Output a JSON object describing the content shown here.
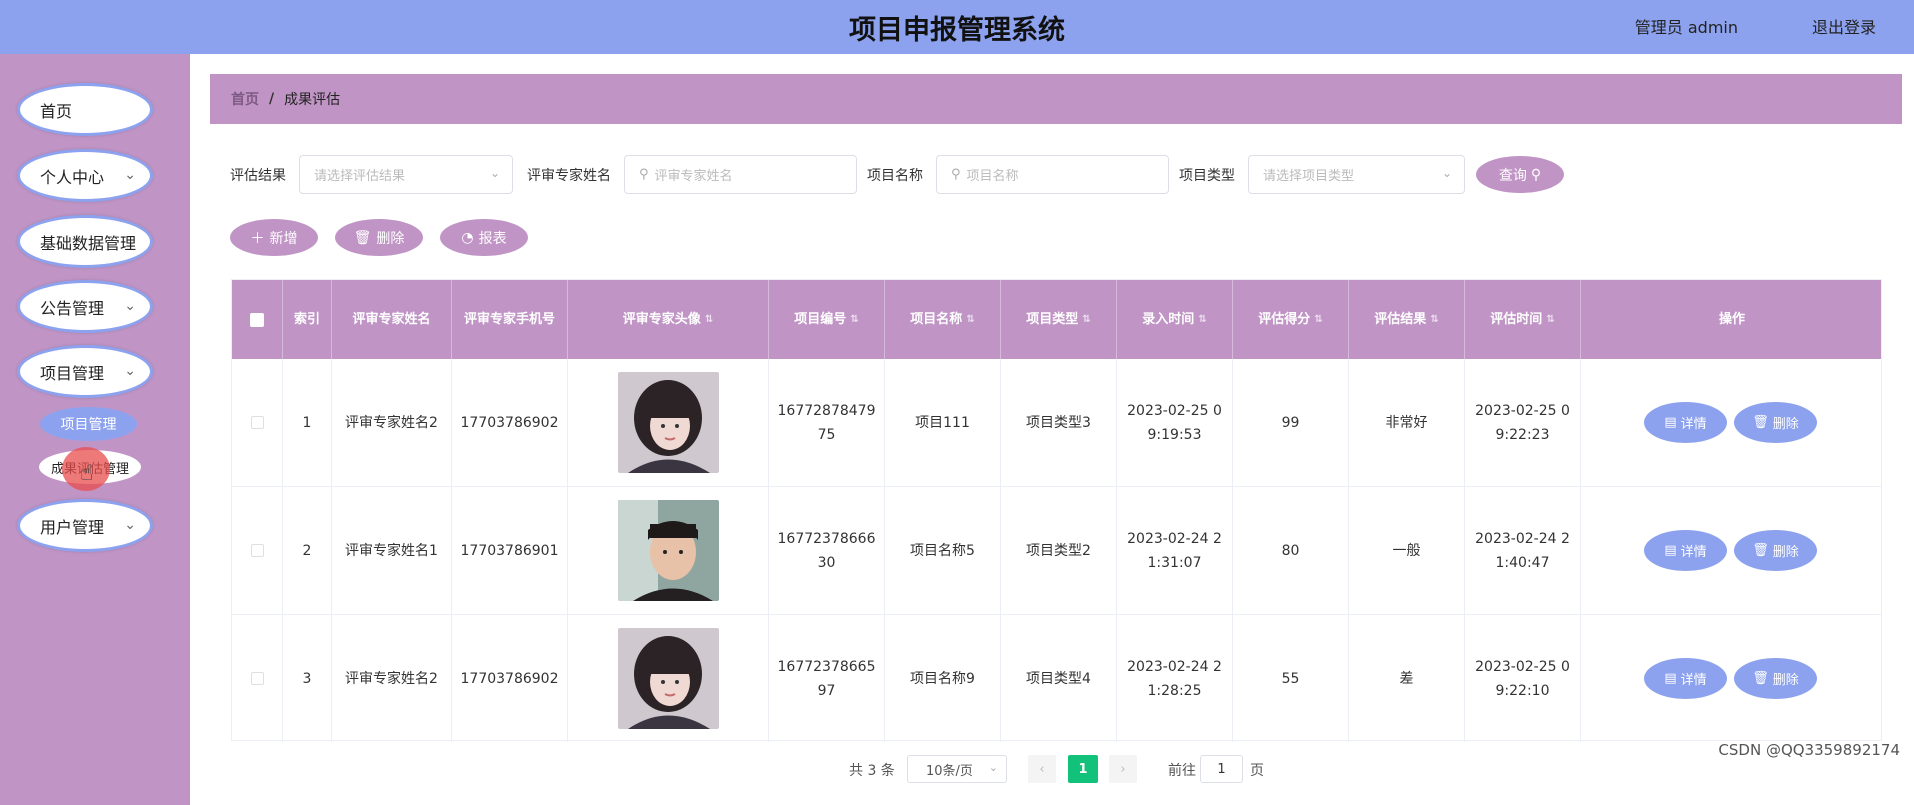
{
  "header": {
    "title": "项目申报管理系统",
    "admin": "管理员 admin",
    "logout": "退出登录"
  },
  "sidebar": {
    "items": [
      {
        "label": "首页",
        "has_arrow": false
      },
      {
        "label": "个人中心",
        "has_arrow": true
      },
      {
        "label": "基础数据管理",
        "has_arrow": true
      },
      {
        "label": "公告管理",
        "has_arrow": true
      },
      {
        "label": "项目管理",
        "has_arrow": true
      },
      {
        "label": "用户管理",
        "has_arrow": true
      }
    ],
    "sub_items": [
      "项目管理",
      "成果评估管理"
    ],
    "chevron": "⌄"
  },
  "breadcrumb": {
    "home": "首页",
    "separator": "/",
    "current": "成果评估"
  },
  "filters": {
    "result_label": "评估结果",
    "result_placeholder": "请选择评估结果",
    "expert_label": "评审专家姓名",
    "expert_placeholder": "评审专家姓名",
    "project_label": "项目名称",
    "project_placeholder": "项目名称",
    "type_label": "项目类型",
    "type_placeholder": "请选择项目类型",
    "search_button": "查询"
  },
  "toolbar": {
    "add": "新增",
    "delete": "删除",
    "report": "报表"
  },
  "table": {
    "headers": {
      "index": "索引",
      "expert_name": "评审专家姓名",
      "expert_phone": "评审专家手机号",
      "expert_avatar": "评审专家头像",
      "project_no": "项目编号",
      "project_name": "项目名称",
      "project_type": "项目类型",
      "entry_time": "录入时间",
      "score": "评估得分",
      "result": "评估结果",
      "eval_time": "评估时间",
      "actions": "操作"
    },
    "rows": [
      {
        "index": "1",
        "expert_name": "评审专家姓名2",
        "expert_phone": "17703786902",
        "project_no": "16772878479 75",
        "project_name": "项目111",
        "project_type": "项目类型3",
        "entry_time": "2023-02-25 0 9:19:53",
        "score": "99",
        "result": "非常好",
        "eval_time": "2023-02-25 0 9:22:23",
        "avatar": "female"
      },
      {
        "index": "2",
        "expert_name": "评审专家姓名1",
        "expert_phone": "17703786901",
        "project_no": "16772378666 30",
        "project_name": "项目名称5",
        "project_type": "项目类型2",
        "entry_time": "2023-02-24 2 1:31:07",
        "score": "80",
        "result": "一般",
        "eval_time": "2023-02-24 2 1:40:47",
        "avatar": "male"
      },
      {
        "index": "3",
        "expert_name": "评审专家姓名2",
        "expert_phone": "17703786902",
        "project_no": "16772378665 97",
        "project_name": "项目名称9",
        "project_type": "项目类型4",
        "entry_time": "2023-02-24 2 1:28:25",
        "score": "55",
        "result": "差",
        "eval_time": "2023-02-25 0 9:22:10",
        "avatar": "female"
      }
    ],
    "detail_button": "详情",
    "delete_button": "删除"
  },
  "pagination": {
    "total": "共 3 条",
    "page_size": "10条/页",
    "current_page": "1",
    "goto_label": "前往",
    "goto_value": "1",
    "page_suffix": "页"
  },
  "watermark": "CSDN @QQ3359892174",
  "colors": {
    "header": "#8da2ee",
    "sidebar": "#c095c6",
    "accent_green": "#13c27a"
  },
  "icons": {
    "search": "search-icon",
    "plus": "plus-icon",
    "trash": "trash-icon",
    "chart": "pie-chart-icon",
    "doc": "document-icon",
    "chevron": "chevron-down-icon"
  }
}
